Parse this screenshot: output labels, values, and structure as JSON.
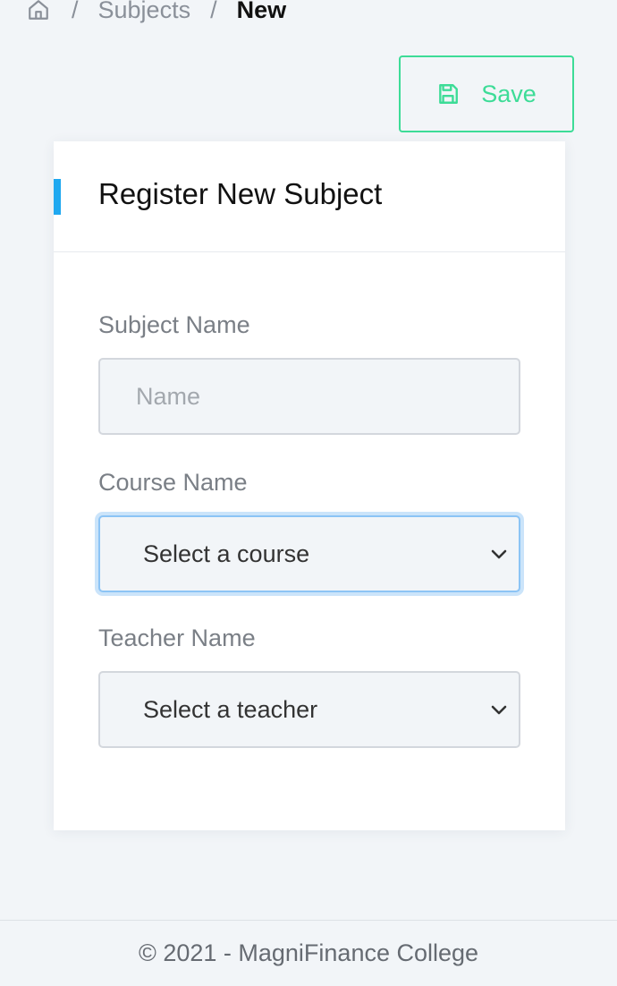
{
  "breadcrumb": {
    "icon": "home-icon",
    "separator": "/",
    "items": [
      "Subjects",
      "New"
    ]
  },
  "toolbar": {
    "save_label": "Save",
    "save_icon": "floppy-disk-icon",
    "accent_color": "#3ddc97"
  },
  "card": {
    "title": "Register New Subject",
    "accent_color": "#1fa8f0"
  },
  "form": {
    "subject": {
      "label": "Subject Name",
      "placeholder": "Name",
      "value": ""
    },
    "course": {
      "label": "Course Name",
      "selected": "Select a course",
      "focused": true
    },
    "teacher": {
      "label": "Teacher Name",
      "selected": "Select a teacher"
    }
  },
  "footer": {
    "text": "© 2021 - MagniFinance College"
  }
}
